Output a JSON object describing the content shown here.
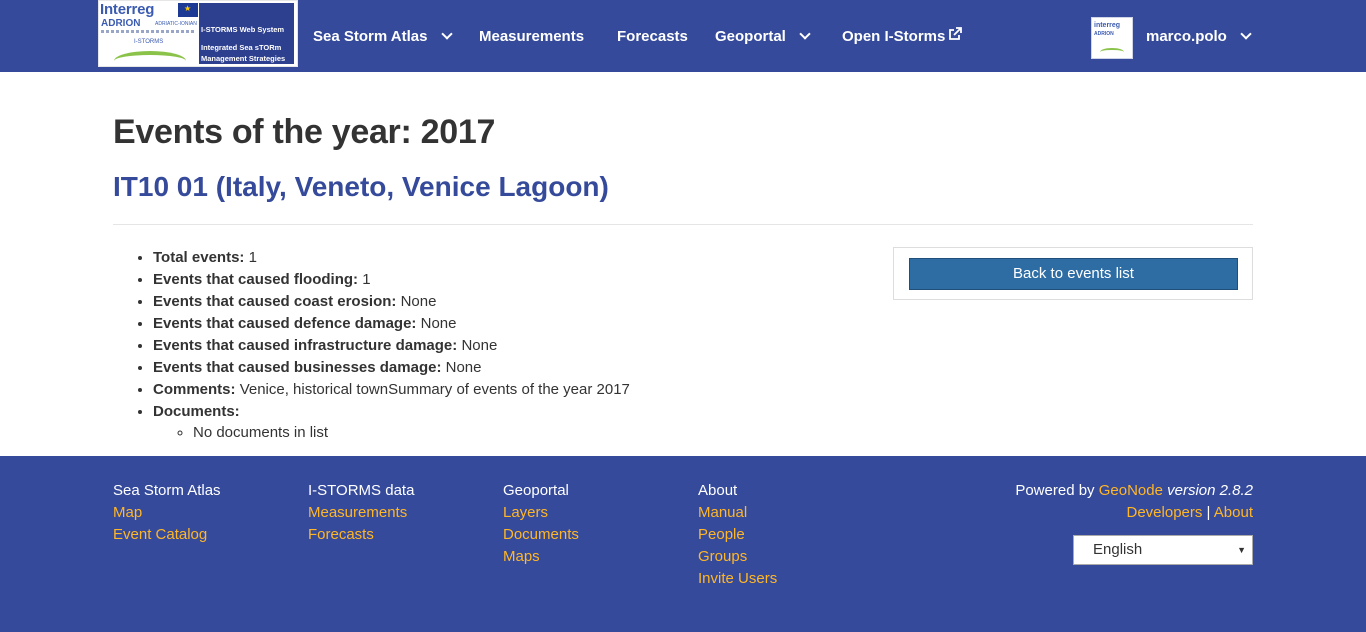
{
  "header": {
    "logo": {
      "interreg": "Interreg",
      "adrion": "ADRION",
      "adriatic_ionian": "ADRIATIC-IONIAN",
      "istorms_small": "I-STORMS",
      "web_system": "I-STORMS Web System",
      "integrated_line1": "Integrated Sea sTORm",
      "integrated_line2": "Management Strategies"
    },
    "nav": [
      {
        "label": "Sea Storm Atlas",
        "dropdown": true
      },
      {
        "label": "Measurements",
        "dropdown": false
      },
      {
        "label": "Forecasts",
        "dropdown": false
      },
      {
        "label": "Geoportal",
        "dropdown": true
      },
      {
        "label": "Open I-Storms",
        "dropdown": false,
        "icon": "external-link-icon"
      }
    ],
    "user": {
      "name": "marco.polo",
      "avatar_text1": "interreg",
      "avatar_text2": "ADRION"
    }
  },
  "main": {
    "title": "Events of the year: 2017",
    "subtitle": "IT10 01 (Italy, Veneto, Venice Lagoon)",
    "details": [
      {
        "label": "Total events:",
        "value": "1"
      },
      {
        "label": "Events that caused flooding:",
        "value": "1"
      },
      {
        "label": "Events that caused coast erosion:",
        "value": "None"
      },
      {
        "label": "Events that caused defence damage:",
        "value": "None"
      },
      {
        "label": "Events that caused infrastructure damage:",
        "value": "None"
      },
      {
        "label": "Events that caused businesses damage:",
        "value": "None"
      },
      {
        "label": "Comments:",
        "value": "Venice, historical townSummary of events of the year 2017"
      },
      {
        "label": "Documents:",
        "value": ""
      }
    ],
    "documents_empty": "No documents in list",
    "back_button": "Back to events list"
  },
  "footer": {
    "columns": [
      {
        "heading": "Sea Storm Atlas",
        "links": [
          "Map",
          "Event Catalog"
        ]
      },
      {
        "heading": "I-STORMS data",
        "links": [
          "Measurements",
          "Forecasts"
        ]
      },
      {
        "heading": "Geoportal",
        "links": [
          "Layers",
          "Documents",
          "Maps"
        ]
      },
      {
        "heading": "About",
        "links": [
          "Manual",
          "People",
          "Groups",
          "Invite Users"
        ]
      }
    ],
    "powered_by": "Powered by",
    "geonode": "GeoNode",
    "version": "version 2.8.2",
    "developers": "Developers",
    "separator": "|",
    "about": "About",
    "language": "English"
  },
  "colors": {
    "brand_blue": "#354a9a",
    "footer_link": "#ffb627",
    "button_blue": "#2e6da4"
  }
}
